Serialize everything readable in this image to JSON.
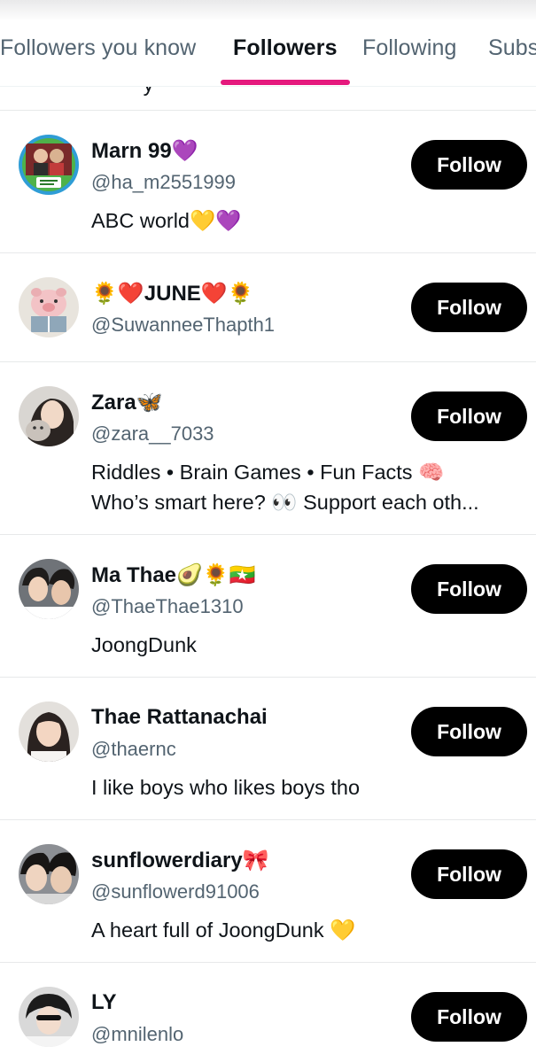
{
  "tabs": [
    {
      "label": "Followers you know"
    },
    {
      "label": "Followers"
    },
    {
      "label": "Following"
    },
    {
      "label": "Subs"
    }
  ],
  "colors": {
    "accent": "#e5197d",
    "button": "#000000",
    "secondary_text": "#536471"
  },
  "users": [
    {
      "name": "Marn 99💜",
      "handle": "@ha_m2551999",
      "bio": [
        "ABC world💛💜"
      ],
      "follow_label": "Follow"
    },
    {
      "name": "🌻❤️JUNE❤️🌻",
      "handle": "@SuwanneeThapth1",
      "bio": [],
      "follow_label": "Follow"
    },
    {
      "name": "Zara🦋",
      "handle": "@zara__7033",
      "bio": [
        "Riddles • Brain Games • Fun Facts 🧠",
        "Who’s smart here? 👀 Support each oth..."
      ],
      "follow_label": "Follow"
    },
    {
      "name": "Ma Thae🥑🌻🇲🇲",
      "handle": "@ThaeThae1310",
      "bio": [
        "JoongDunk"
      ],
      "follow_label": "Follow"
    },
    {
      "name": "Thae Rattanachai",
      "handle": "@thaernc",
      "bio": [
        "I like boys who likes boys tho"
      ],
      "follow_label": "Follow"
    },
    {
      "name": "sunflowerdiary🎀",
      "handle": "@sunflowerd91006",
      "bio": [
        "A heart full of JoongDunk 💛"
      ],
      "follow_label": "Follow"
    },
    {
      "name": "LY",
      "handle": "@mnilenlo",
      "bio": [],
      "follow_label": "Follow"
    }
  ]
}
